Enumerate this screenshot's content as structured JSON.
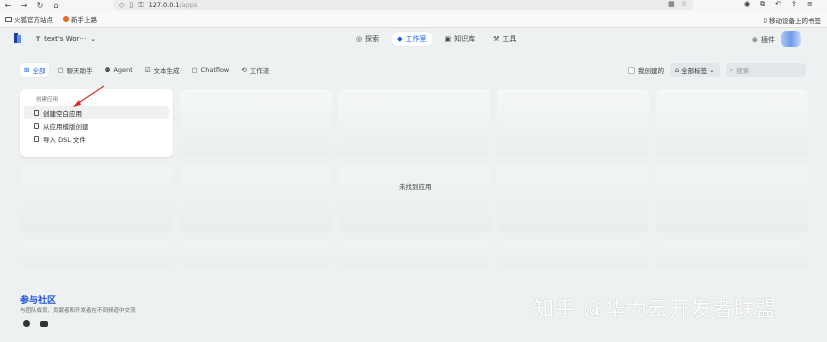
{
  "browser": {
    "url_host": "127.0.0.1",
    "url_path": "/apps"
  },
  "bookmarks": {
    "items": [
      {
        "label": "火狐官方站点",
        "icon": "folder-icon"
      },
      {
        "label": "新手上路",
        "icon": "firefox-icon"
      }
    ],
    "mobile_label": "移动设备上的书签"
  },
  "header": {
    "workspace_initial": "T",
    "workspace_name": "text's Wor···",
    "nav": [
      {
        "label": "探索",
        "icon": "compass-icon"
      },
      {
        "label": "工作室",
        "icon": "studio-icon",
        "active": true
      },
      {
        "label": "知识库",
        "icon": "book-icon"
      },
      {
        "label": "工具",
        "icon": "tool-icon"
      }
    ],
    "plugin_label": "插件"
  },
  "tabs": [
    {
      "label": "全部",
      "icon": "grid-icon",
      "active": true
    },
    {
      "label": "聊天助手",
      "icon": "chat-icon"
    },
    {
      "label": "Agent",
      "icon": "agent-icon"
    },
    {
      "label": "文本生成",
      "icon": "text-icon"
    },
    {
      "label": "Chatflow",
      "icon": "chatflow-icon"
    },
    {
      "label": "工作流",
      "icon": "workflow-icon"
    }
  ],
  "filters": {
    "mine_label": "我创建的",
    "tags_label": "全部标签",
    "search_placeholder": "搜索"
  },
  "create_card": {
    "title": "创建应用",
    "items": [
      {
        "label": "创建空白应用",
        "icon": "file-icon"
      },
      {
        "label": "从应用模版创建",
        "icon": "template-icon"
      },
      {
        "label": "导入 DSL 文件",
        "icon": "import-icon"
      }
    ]
  },
  "empty_text": "未找到应用",
  "community": {
    "title": "参与社区",
    "desc": "与团队成员、贡献者和开发者在不同频道中交流"
  },
  "watermark": "知乎 @华为云开发者联盟",
  "colors": {
    "accent": "#155eef",
    "annotation_arrow": "#d9322b"
  }
}
